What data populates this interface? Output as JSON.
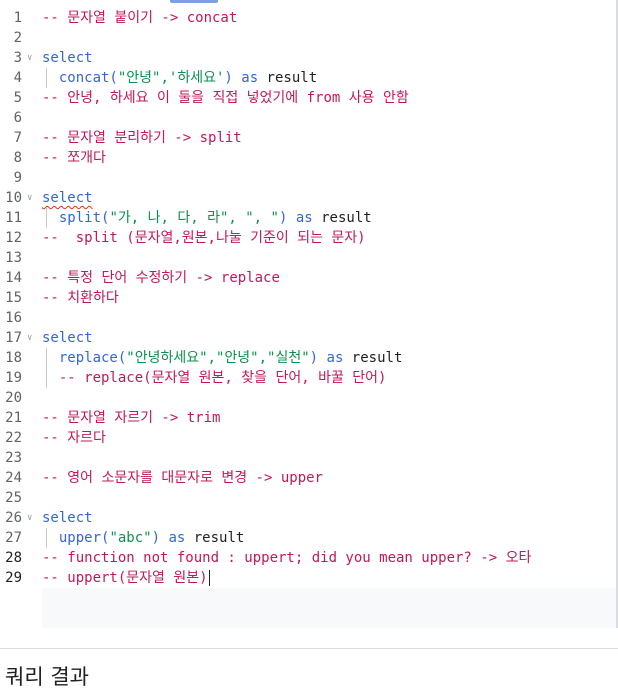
{
  "editor": {
    "lines": [
      {
        "n": "1",
        "tokens": [
          {
            "t": "-- 문자열 붙이기 -> concat",
            "c": "comment"
          }
        ]
      },
      {
        "n": "2",
        "tokens": []
      },
      {
        "n": "3",
        "fold": true,
        "tokens": [
          {
            "t": "select",
            "c": "keyword"
          }
        ]
      },
      {
        "n": "4",
        "guide": true,
        "tokens": [
          {
            "t": "  concat(",
            "c": "keyword"
          },
          {
            "t": "\"안녕\",'하세요'",
            "c": "string"
          },
          {
            "t": ") ",
            "c": "keyword"
          },
          {
            "t": "as",
            "c": "keyword"
          },
          {
            "t": " result",
            "c": "ident"
          }
        ]
      },
      {
        "n": "5",
        "tokens": [
          {
            "t": "-- 안녕, 하세요 이 둘을 직접 넣었기에 from 사용 안함",
            "c": "comment"
          }
        ]
      },
      {
        "n": "6",
        "tokens": []
      },
      {
        "n": "7",
        "tokens": [
          {
            "t": "-- 문자열 분리하기 -> split",
            "c": "comment"
          }
        ]
      },
      {
        "n": "8",
        "tokens": [
          {
            "t": "-- 쪼개다",
            "c": "comment"
          }
        ]
      },
      {
        "n": "9",
        "tokens": []
      },
      {
        "n": "10",
        "fold": true,
        "tokens": [
          {
            "t": "select",
            "c": "keyword",
            "wavy": true
          }
        ]
      },
      {
        "n": "11",
        "guide": true,
        "tokens": [
          {
            "t": "  split(",
            "c": "keyword"
          },
          {
            "t": "\"가, 나, 다, 라\", \", \"",
            "c": "string"
          },
          {
            "t": ") ",
            "c": "keyword"
          },
          {
            "t": "as",
            "c": "keyword"
          },
          {
            "t": " result",
            "c": "ident"
          }
        ]
      },
      {
        "n": "12",
        "tokens": [
          {
            "t": "--  split (문자열,원본,나눌 기준이 되는 문자)",
            "c": "comment"
          }
        ]
      },
      {
        "n": "13",
        "tokens": []
      },
      {
        "n": "14",
        "tokens": [
          {
            "t": "-- 특정 단어 수정하기 -> replace",
            "c": "comment"
          }
        ]
      },
      {
        "n": "15",
        "tokens": [
          {
            "t": "-- 치환하다",
            "c": "comment"
          }
        ]
      },
      {
        "n": "16",
        "tokens": []
      },
      {
        "n": "17",
        "fold": true,
        "tokens": [
          {
            "t": "select",
            "c": "keyword"
          }
        ]
      },
      {
        "n": "18",
        "guide": true,
        "tokens": [
          {
            "t": "  replace(",
            "c": "keyword"
          },
          {
            "t": "\"안녕하세요\",\"안녕\",\"실천\"",
            "c": "string"
          },
          {
            "t": ") ",
            "c": "keyword"
          },
          {
            "t": "as",
            "c": "keyword"
          },
          {
            "t": " result",
            "c": "ident"
          }
        ]
      },
      {
        "n": "19",
        "guide": true,
        "tokens": [
          {
            "t": "  -- replace(문자열 원본, 찾을 단어, 바꿀 단어)",
            "c": "comment"
          }
        ]
      },
      {
        "n": "20",
        "tokens": []
      },
      {
        "n": "21",
        "tokens": [
          {
            "t": "-- 문자열 자르기 -> trim",
            "c": "comment"
          }
        ]
      },
      {
        "n": "22",
        "tokens": [
          {
            "t": "-- 자르다",
            "c": "comment"
          }
        ]
      },
      {
        "n": "23",
        "tokens": []
      },
      {
        "n": "24",
        "tokens": [
          {
            "t": "-- 영어 소문자를 대문자로 변경 -> upper",
            "c": "comment"
          }
        ]
      },
      {
        "n": "25",
        "tokens": []
      },
      {
        "n": "26",
        "fold": true,
        "tokens": [
          {
            "t": "select",
            "c": "keyword"
          }
        ]
      },
      {
        "n": "27",
        "guide": true,
        "tokens": [
          {
            "t": "  upper(",
            "c": "keyword"
          },
          {
            "t": "\"abc\"",
            "c": "string"
          },
          {
            "t": ") ",
            "c": "keyword"
          },
          {
            "t": "as",
            "c": "keyword"
          },
          {
            "t": " result",
            "c": "ident"
          }
        ]
      },
      {
        "n": "28",
        "active": true,
        "tokens": [
          {
            "t": "-- function not found : uppert; did you mean upper? -> 오타",
            "c": "comment"
          }
        ]
      },
      {
        "n": "29",
        "active": true,
        "caret": true,
        "tokens": [
          {
            "t": "-- uppert(문자열 원본)",
            "c": "comment"
          }
        ]
      }
    ]
  },
  "results": {
    "title": "쿼리 결과"
  },
  "colors": {
    "comment": "#c2185b",
    "keyword": "#3367d6",
    "string": "#0d904f",
    "ident": "#202124"
  }
}
